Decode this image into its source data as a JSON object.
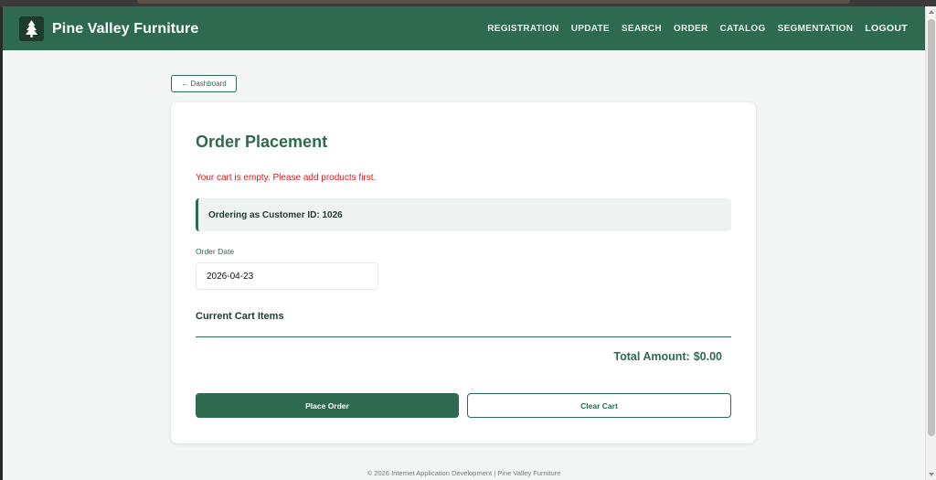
{
  "navbar": {
    "brand": "Pine Valley Furniture",
    "links": [
      "REGISTRATION",
      "UPDATE",
      "SEARCH",
      "ORDER",
      "CATALOG",
      "SEGMENTATION"
    ],
    "logout": "LOGOUT"
  },
  "back_button": "← Dashboard",
  "card": {
    "title": "Order Placement",
    "error": "Your cart is empty. Please add products first.",
    "customer_info": "Ordering as Customer ID: 1026",
    "order_date_label": "Order Date",
    "order_date_value": "2026-04-23",
    "cart_title": "Current Cart Items",
    "total_label": "Total Amount:",
    "total_value": "$0.00",
    "place_order": "Place Order",
    "clear_cart": "Clear Cart"
  },
  "footer": "© 2026 Internet Application Development | Pine Valley Furniture",
  "colors": {
    "primary": "#2d6a4f",
    "error": "#d81b1b",
    "background": "#f4f6f6"
  },
  "icons": {
    "brand": "pine-tree-icon"
  }
}
